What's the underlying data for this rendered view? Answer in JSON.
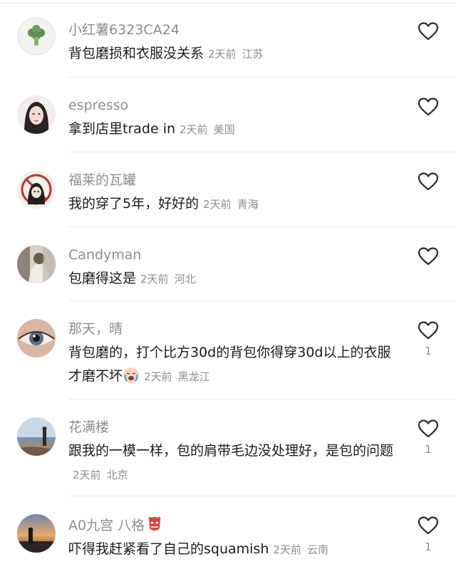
{
  "comments": [
    {
      "username": "小红薯6323CA24",
      "text": "背包磨损和衣服没关系",
      "time": "2天前",
      "location": "江苏",
      "likes": ""
    },
    {
      "username": "espresso",
      "text": "拿到店里trade in",
      "time": "2天前",
      "location": "美国",
      "likes": ""
    },
    {
      "username": "福莱的瓦罐",
      "text": "我的穿了5年，好好的",
      "time": "2天前",
      "location": "青海",
      "likes": ""
    },
    {
      "username": "Candyman",
      "text": "包磨得这是",
      "time": "2天前",
      "location": "河北",
      "likes": ""
    },
    {
      "username": "那天，晴",
      "text": "背包磨的，打个比方30d的背包你得穿30d以上的衣服才磨不坏",
      "time": "2天前",
      "location": "黑龙江",
      "likes": "1"
    },
    {
      "username": "花满楼",
      "text": "跟我的一模一样，包的肩带毛边没处理好，是包的问题",
      "time": "2天前",
      "location": "北京",
      "likes": "1"
    },
    {
      "username": "A0九宫 八格",
      "text": "吓得我赶紧看了自己的squamish",
      "time": "2天前",
      "location": "云南",
      "likes": "1"
    }
  ],
  "icons": {
    "like": "heart-outline-icon",
    "crying_emoji": "crying-face-emoji",
    "mask_emoji": "red-mask-emoji"
  }
}
